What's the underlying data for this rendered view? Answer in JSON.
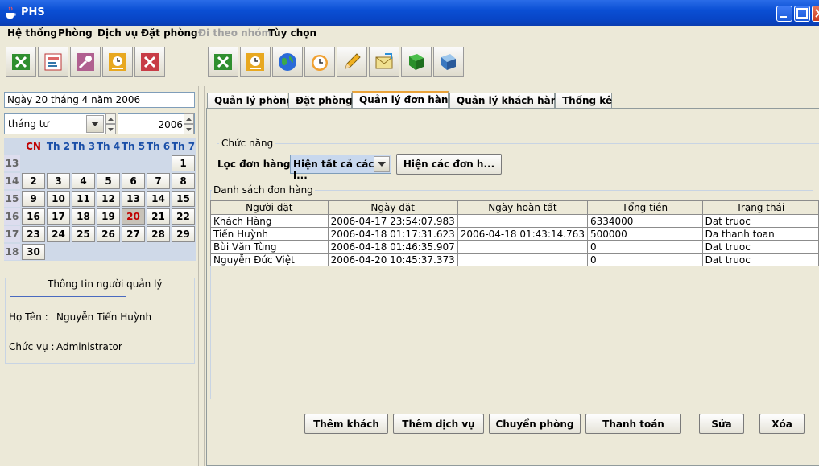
{
  "window": {
    "title": "PHS"
  },
  "menu": [
    {
      "label": "Hệ thống",
      "disabled": false
    },
    {
      "label": "Phòng",
      "disabled": false
    },
    {
      "label": "Dịch vụ",
      "disabled": false
    },
    {
      "label": "Đặt phòng",
      "disabled": false
    },
    {
      "label": "Đi theo nhóm",
      "disabled": true
    },
    {
      "label": "Tùy chọn",
      "disabled": false
    }
  ],
  "toolbar": {
    "group1": [
      "excel-icon",
      "report-icon",
      "key-icon",
      "clock-note-icon",
      "close-doc-icon"
    ],
    "group2": [
      "excel-icon",
      "clock-note-icon",
      "globe-icon",
      "alarm-clock-icon",
      "pencil-icon",
      "mail-icon",
      "book-icon",
      "notebook-icon"
    ]
  },
  "calendar": {
    "date_display": "Ngày 20 tháng 4 năm 2006",
    "month": "tháng tư",
    "year": "2006",
    "weekdays": [
      "CN",
      "Th 2",
      "Th 3",
      "Th 4",
      "Th 5",
      "Th 6",
      "Th 7"
    ],
    "weeks": [
      {
        "week": "13",
        "days": [
          "",
          "",
          "",
          "",
          "",
          "",
          "1"
        ]
      },
      {
        "week": "14",
        "days": [
          "2",
          "3",
          "4",
          "5",
          "6",
          "7",
          "8"
        ]
      },
      {
        "week": "15",
        "days": [
          "9",
          "10",
          "11",
          "12",
          "13",
          "14",
          "15"
        ]
      },
      {
        "week": "16",
        "days": [
          "16",
          "17",
          "18",
          "19",
          "20",
          "21",
          "22"
        ]
      },
      {
        "week": "17",
        "days": [
          "23",
          "24",
          "25",
          "26",
          "27",
          "28",
          "29"
        ]
      },
      {
        "week": "18",
        "days": [
          "30",
          "",
          "",
          "",
          "",
          "",
          ""
        ]
      }
    ],
    "selected_day": "20",
    "sunday_color": "#c00000",
    "weekday_color": "#1a4fa8"
  },
  "manager": {
    "title": "Thông tin người quản lý",
    "name_label": "Họ Tên :",
    "name": "Nguyễn Tiến Huỳnh",
    "role_label": "Chức vụ :",
    "role": "Administrator"
  },
  "tabs": [
    {
      "label": "Quản lý phòng",
      "active": false
    },
    {
      "label": "Đặt phòng",
      "active": false
    },
    {
      "label": "Quản lý đơn hàng",
      "active": true
    },
    {
      "label": "Quản lý khách hàng",
      "active": false
    },
    {
      "label": "Thống kê",
      "active": false
    }
  ],
  "functions": {
    "legend": "Chức năng",
    "filter_label": "Lọc đơn hàng",
    "filter_value": "Hiện tất cả các l...",
    "show_button": "Hiện các đơn h..."
  },
  "orders": {
    "legend": "Danh sách đơn hàng",
    "columns": [
      "Người đặt",
      "Ngày đặt",
      "Ngày hoàn tất",
      "Tổng tiền",
      "Trạng thái"
    ],
    "rows": [
      [
        "Khách  Hàng",
        "2006-04-17 23:54:07.983",
        "",
        "6334000",
        "Dat truoc"
      ],
      [
        "Tiến  Huỳnh",
        "2006-04-18 01:17:31.623",
        "2006-04-18 01:43:14.763",
        "500000",
        "Da thanh toan"
      ],
      [
        "Bùi Văn  Tùng",
        "2006-04-18 01:46:35.907",
        "",
        "0",
        "Dat truoc"
      ],
      [
        "Nguyễn Đức Việt",
        "2006-04-20 10:45:37.373",
        "",
        "0",
        "Dat truoc"
      ]
    ]
  },
  "actions": [
    "Thêm khách",
    "Thêm dịch vụ",
    "Chuyển phòng",
    "Thanh toán",
    "Sửa",
    "Xóa"
  ]
}
